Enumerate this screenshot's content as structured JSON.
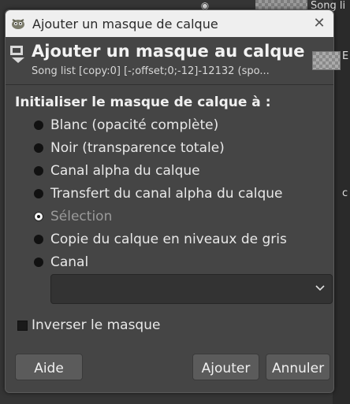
{
  "background": {
    "layer_label": "Song li",
    "edge_label_1": "E",
    "edge_label_2": "c"
  },
  "dialog": {
    "window_title": "Ajouter un masque de calque",
    "header_title": "Ajouter un masque au calque",
    "header_subtitle": "Song list [copy:0] [-;offset;0;-12]-12132 (spo...",
    "section_label": "Initialiser le masque de calque à :",
    "options": [
      {
        "label": "Blanc (opacité complète)",
        "selected": false,
        "enabled": true
      },
      {
        "label": "Noir (transparence totale)",
        "selected": false,
        "enabled": true
      },
      {
        "label": "Canal alpha du calque",
        "selected": false,
        "enabled": true
      },
      {
        "label": "Transfert du canal alpha du calque",
        "selected": false,
        "enabled": true
      },
      {
        "label": "Sélection",
        "selected": true,
        "enabled": false
      },
      {
        "label": "Copie du calque en niveaux de gris",
        "selected": false,
        "enabled": true
      },
      {
        "label": "Canal",
        "selected": false,
        "enabled": true
      }
    ],
    "channel_combo_value": "",
    "invert_label": "Inverser le masque",
    "invert_checked": false,
    "buttons": {
      "help": "Aide",
      "add": "Ajouter",
      "cancel": "Annuler"
    },
    "close_glyph": "✕"
  },
  "colors": {
    "dialog_bg": "#454545",
    "titlebar_bg": "#efefef",
    "button_bg": "#5b5b5b"
  }
}
